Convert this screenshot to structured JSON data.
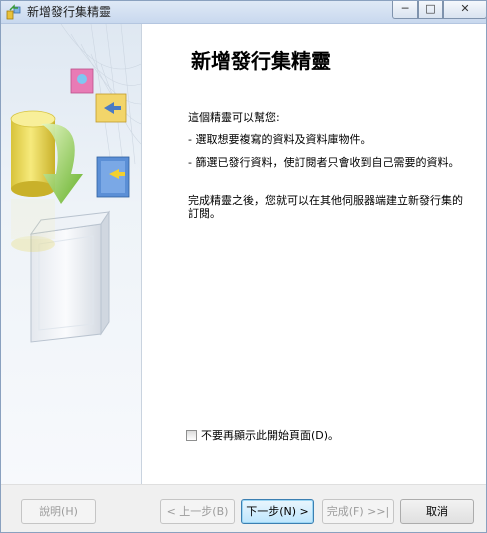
{
  "window": {
    "title": "新增發行集精靈",
    "controls": {
      "minimize": "─",
      "maximize": "□",
      "close": "✕"
    }
  },
  "content": {
    "heading": "新增發行集精靈",
    "intro": "這個精靈可以幫您:",
    "bullets": [
      "- 選取想要複寫的資料及資料庫物件。",
      "- 篩選已發行資料，使訂閱者只會收到自己需要的資料。"
    ],
    "closing": "完成精靈之後，您就可以在其他伺服器端建立新發行集的訂閱。"
  },
  "checkbox": {
    "label": "不要再顯示此開始頁面(D)。",
    "checked": false
  },
  "buttons": {
    "help": "說明(H)",
    "back": "< 上一步(B)",
    "next": "下一步(N) >",
    "finish": "完成(F) >>|",
    "cancel": "取消"
  },
  "colors": {
    "cylinder": "#e9d84a",
    "arrow": "#8ec63f",
    "book_blue": "#5b8fd6",
    "folder_yellow": "#f2d56a",
    "pink_icon": "#e87bb5"
  }
}
